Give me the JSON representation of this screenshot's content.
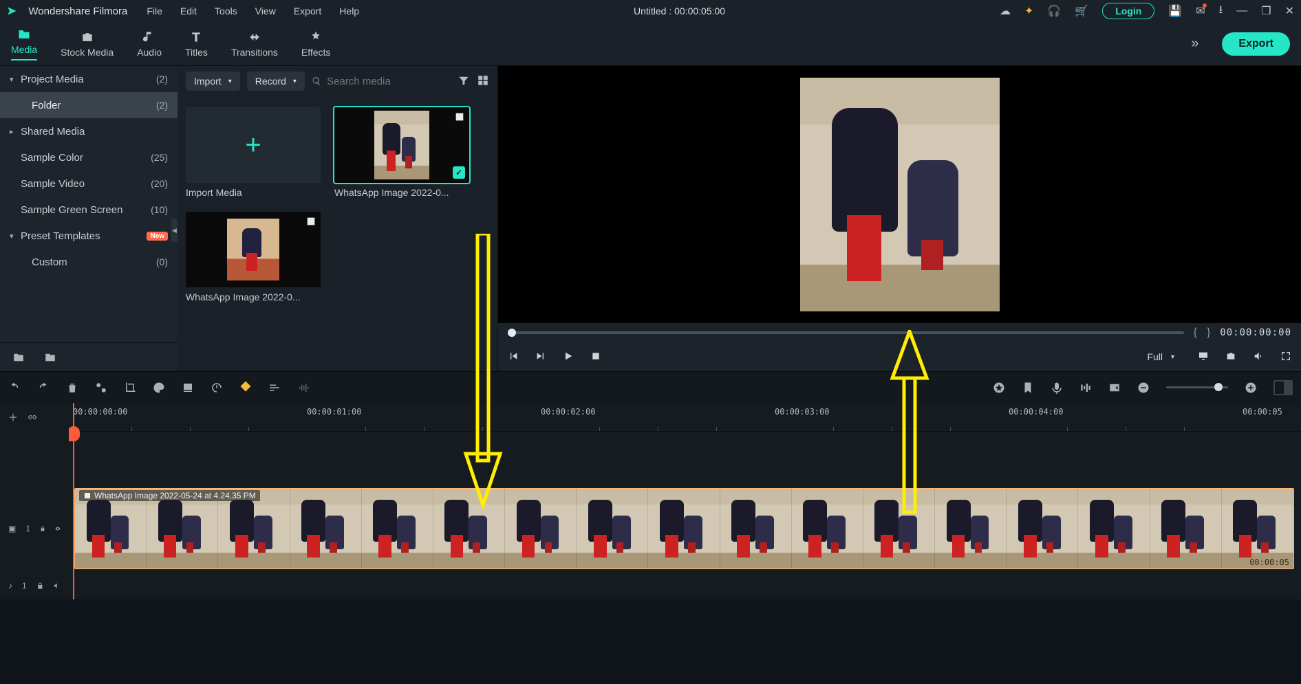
{
  "app": {
    "name": "Wondershare Filmora",
    "title": "Untitled : 00:00:05:00"
  },
  "menu": {
    "file": "File",
    "edit": "Edit",
    "tools": "Tools",
    "view": "View",
    "export": "Export",
    "help": "Help"
  },
  "login_label": "Login",
  "tabs": {
    "media": "Media",
    "stock": "Stock Media",
    "audio": "Audio",
    "titles": "Titles",
    "transitions": "Transitions",
    "effects": "Effects"
  },
  "export_btn": "Export",
  "sidebar": {
    "project_media": {
      "label": "Project Media",
      "count": "(2)"
    },
    "folder": {
      "label": "Folder",
      "count": "(2)"
    },
    "shared_media": {
      "label": "Shared Media",
      "count": ""
    },
    "sample_color": {
      "label": "Sample Color",
      "count": "(25)"
    },
    "sample_video": {
      "label": "Sample Video",
      "count": "(20)"
    },
    "sample_green": {
      "label": "Sample Green Screen",
      "count": "(10)"
    },
    "preset": {
      "label": "Preset Templates",
      "badge": "New"
    },
    "custom": {
      "label": "Custom",
      "count": "(0)"
    }
  },
  "media_toolbar": {
    "import": "Import",
    "record": "Record",
    "search_placeholder": "Search media"
  },
  "media_items": {
    "import_label": "Import Media",
    "item1": "WhatsApp Image 2022-0...",
    "item2": "WhatsApp Image 2022-0..."
  },
  "preview": {
    "timecode": "00:00:00:00",
    "resolution": "Full"
  },
  "ruler": {
    "t0": "00:00:00:00",
    "t1": "00:00:01:00",
    "t2": "00:00:02:00",
    "t3": "00:00:03:00",
    "t4": "00:00:04:00",
    "t5": "00:00:05"
  },
  "clip": {
    "label": "WhatsApp Image 2022-05-24 at 4.24.35 PM",
    "end_tc": "00:00:05"
  },
  "track": {
    "video_label": "1",
    "audio_label": "1"
  }
}
